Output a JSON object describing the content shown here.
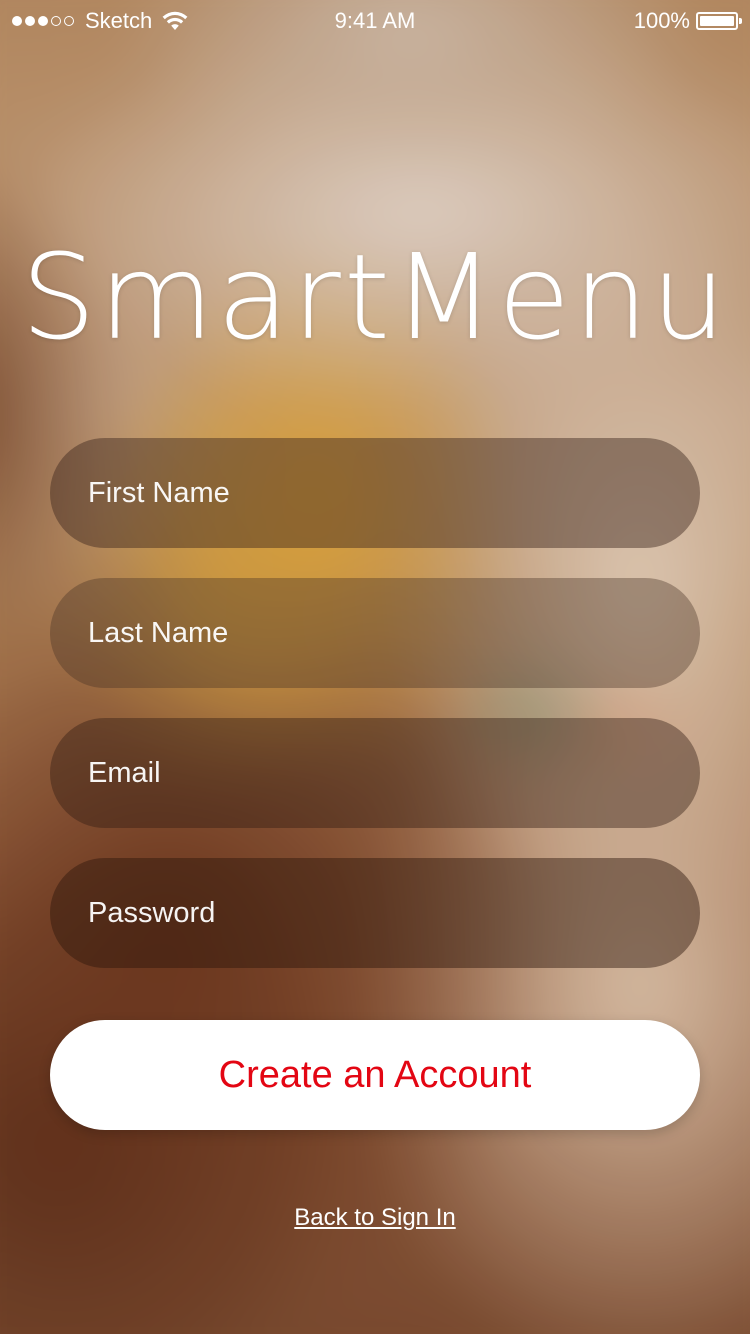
{
  "status_bar": {
    "carrier": "Sketch",
    "time": "9:41 AM",
    "battery": "100%",
    "signal_bars_filled": 3,
    "signal_bars_total": 5,
    "battery_level": 1.0
  },
  "app": {
    "title": "SmartMenu"
  },
  "form": {
    "first_name": {
      "placeholder": "First Name",
      "value": ""
    },
    "last_name": {
      "placeholder": "Last Name",
      "value": ""
    },
    "email": {
      "placeholder": "Email",
      "value": ""
    },
    "password": {
      "placeholder": "Password",
      "value": ""
    }
  },
  "actions": {
    "create_account": "Create an Account",
    "back_to_sign_in": "Back to Sign In"
  },
  "colors": {
    "accent": "#e30613",
    "button_bg": "#ffffff",
    "text": "#ffffff"
  },
  "icons": {
    "wifi": "wifi-icon",
    "battery": "battery-icon",
    "signal": "signal-strength-icon"
  }
}
